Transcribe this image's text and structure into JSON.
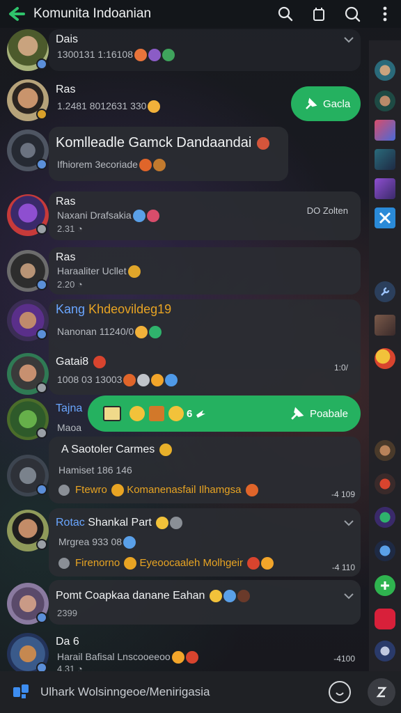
{
  "header": {
    "title": "Komunita Indoanian",
    "back_icon": "back-arrow-icon",
    "search_icon": "search-icon",
    "copy_icon": "copy-icon",
    "chat_search_icon": "chat-search-icon",
    "menu_icon": "more-vertical-icon",
    "accent": "#25b160"
  },
  "items": [
    {
      "name": "Dais",
      "meta": "1300131 1:16108"
    },
    {
      "name": "Ras",
      "meta": "1.2481 8012631 330"
    },
    {
      "name": "Komlleadle Gamck Dandaandai",
      "meta": "Ifhiorem 3ecoriade"
    },
    {
      "name": "Ras",
      "meta": "Naxani Drafsakia",
      "time": "2.31",
      "right": "DO Zolten"
    },
    {
      "name": "Ras",
      "meta": "Haraaliter Ucllet",
      "time": "2.20"
    },
    {
      "name_prefix": "Kang",
      "name": "Khdeovildeg19",
      "meta": "Nanonan 11240/0"
    },
    {
      "name": "Gatai8",
      "meta": "1008 03 13003",
      "right": "1:0/"
    },
    {
      "name": "Tajna",
      "meta": "Maoa"
    },
    {
      "name": "A Saotoler Carmes",
      "meta": "Hamiset 186 146",
      "tag": "Ftewro",
      "tag_text": "Komanenasfail Ilhamgsa",
      "right": "-4 109"
    },
    {
      "name_prefix": "Rotac",
      "name": "Shankal Part",
      "meta": "Mrgrea 933 08",
      "tag": "Firenorno",
      "tag_text": "Eyeoocaaleh Molhgeir",
      "right": "-4 110"
    },
    {
      "name": "Pomt Coapkaa danane Eahan",
      "meta": "2399"
    },
    {
      "name": "Da 6",
      "meta": "Harail Bafisal Lnscooeeoo",
      "time": "4.31",
      "right": "-4100"
    }
  ],
  "pills": {
    "swipe_action": "Gacla",
    "forward_action": "Poabale"
  },
  "composer": {
    "placeholder": "Ulhark Wolsinngeoe/Menirigasia",
    "left_icon": "app-logo-icon",
    "emoji_icon": "emoji-icon",
    "attach_icon": "attach-icon"
  },
  "rail_icons": [
    "avatar-1",
    "avatar-2",
    "thumb-1",
    "thumb-2",
    "thumb-3",
    "x-icon",
    "tool-icon",
    "thumb-4",
    "emoji-fire",
    "avatar-3",
    "avatar-4",
    "avatar-5",
    "avatar-6",
    "add-icon",
    "sticker-icon",
    "game-icon"
  ]
}
